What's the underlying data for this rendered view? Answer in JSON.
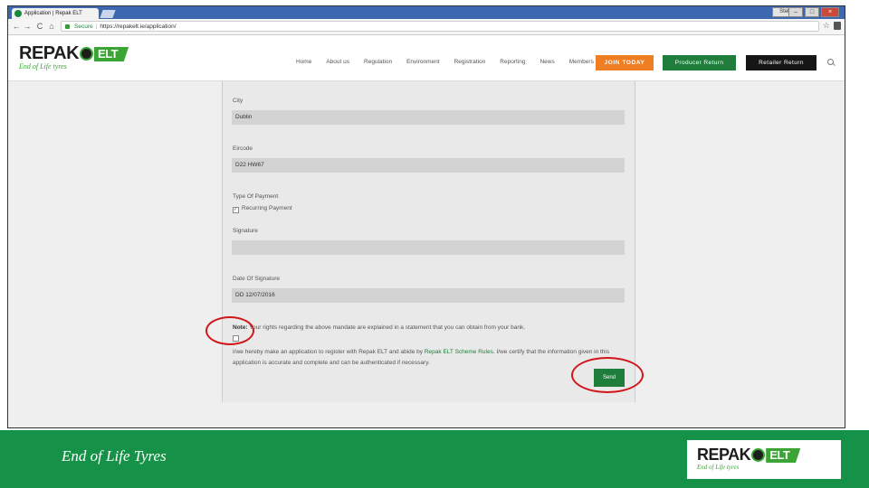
{
  "browser": {
    "tab_title": "Application | Repak ELT",
    "window_user_label": "Stell",
    "url_secure_label": "Secure",
    "url": "https://repakelt.ie/application/",
    "back_glyph": "←",
    "forward_glyph": "→",
    "reload_glyph": "C",
    "home_glyph": "⌂",
    "star_glyph": "☆",
    "min_glyph": "–",
    "max_glyph": "□",
    "close_glyph": "×"
  },
  "site": {
    "logo_word_a": "REPAK",
    "logo_word_b": "ELT",
    "logo_tagline": "End of Life tyres",
    "nav": [
      "Home",
      "About us",
      "Regulation",
      "Environment",
      "Registration",
      "Reporting",
      "News",
      "Members"
    ],
    "join_label": "JOIN TODAY",
    "producer_label": "Producer Return",
    "retailer_label": "Retailer Return"
  },
  "form": {
    "city_label": "City",
    "city_value": "Dublin",
    "eircode_label": "Eircode",
    "eircode_value": "D22 HW67",
    "payment_label": "Type Of Payment",
    "payment_option": "Recurring Payment",
    "payment_checked": true,
    "signature_label": "Signature",
    "signature_value": "",
    "date_label": "Date Of Signature",
    "date_value": "DD 12/07/2016",
    "note_bold": "Note:",
    "note_text": " Your rights regarding the above mandate are explained in a statement that you can obtain from your bank.",
    "agree_checked": false,
    "declaration_a": "I/we hereby make an application to register with Repak ELT and abide by ",
    "declaration_link": "Repak ELT Scheme Rules",
    "declaration_b": ". I/we certify that the information given in this application is accurate and complete and can be authenticated if necessary.",
    "send_label": "Send"
  },
  "annotation_color": "#d0161a",
  "footer": {
    "tagline": "End of Life Tyres",
    "logo_word_a": "REPAK",
    "logo_word_b": "ELT",
    "logo_tagline": "End of Life tyres"
  },
  "colors": {
    "brand_green": "#1e7d3a",
    "join_orange": "#ef7d22",
    "footer_green": "#169248"
  }
}
